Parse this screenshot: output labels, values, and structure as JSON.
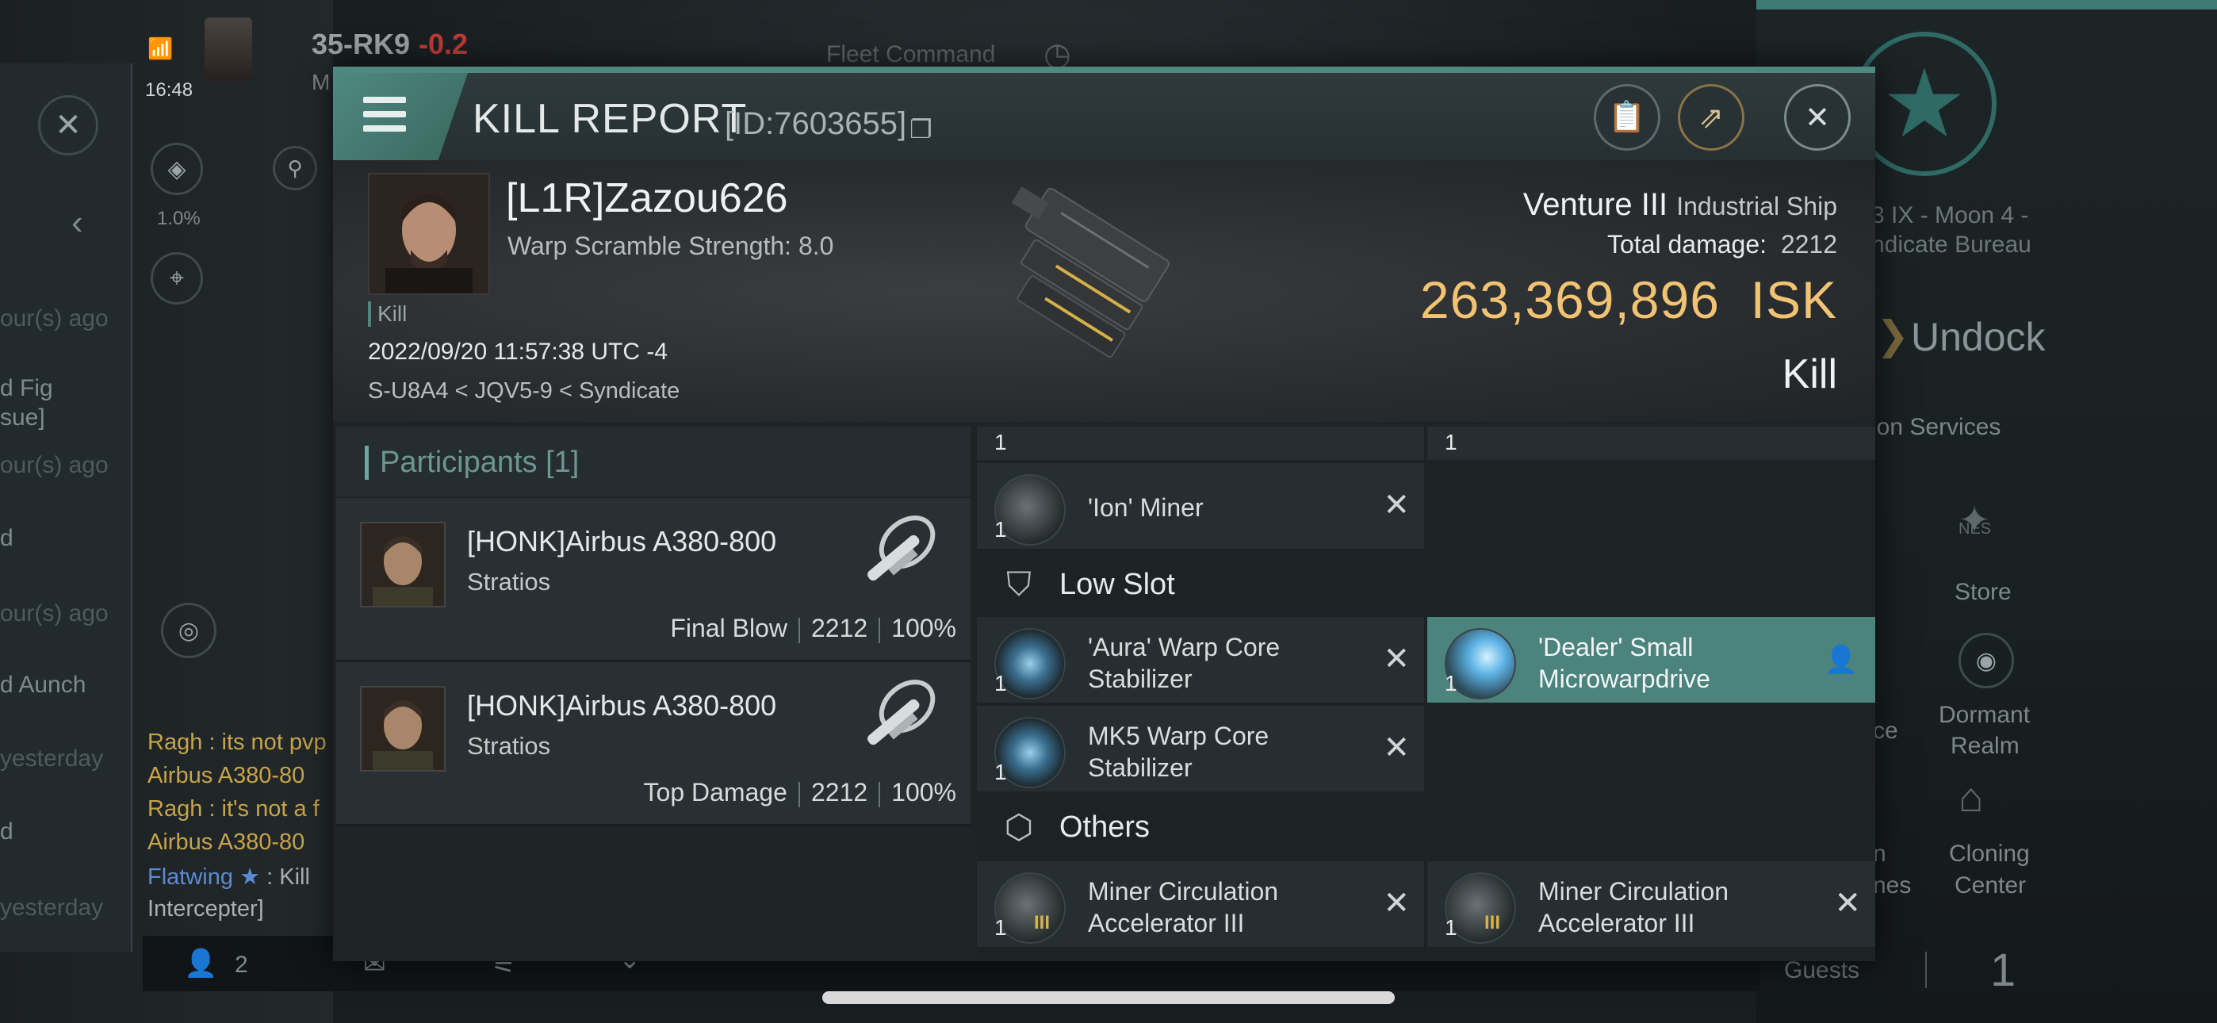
{
  "background": {
    "time": "16:48",
    "system_name": "35-RK9",
    "security": "-0.2",
    "letter_m": "M",
    "percent": "1.0%",
    "fleet_command": "Fleet Command",
    "left_list": [
      "our(s) ago",
      "d Fig",
      "sue]",
      "our(s) ago",
      "d",
      "our(s) ago",
      "d Aunch",
      "yesterday",
      "d",
      "yesterday"
    ],
    "chat": [
      {
        "name": "Ragh",
        "text": " : its not pvp"
      },
      {
        "name": "Airbus A380-80",
        "text": ""
      },
      {
        "name": "Ragh",
        "text": " : it's not a f"
      },
      {
        "name": "Airbus A380-80",
        "text": ""
      },
      {
        "name": "Flatwing",
        "text": " : Kill"
      },
      {
        "name": "",
        "text": "Intercepter]"
      }
    ],
    "bottom_count": "2",
    "right_location_line1": "3 IX - Moon 4 -",
    "right_location_line2": "ndicate Bureau",
    "undock": "Undock",
    "station_services": "ion Services",
    "store": "Store",
    "ce": "ce",
    "dormant_line1": "Dormant",
    "dormant_line2": "Realm",
    "cloning_line1": "Cloning",
    "cloning_line2": "Center",
    "nes": "NES",
    "n_partial": "n",
    "nes_partial": "nes",
    "guests_label": "Guests",
    "guests_count": "1"
  },
  "modal": {
    "title": "KILL REPORT",
    "report_id": "[ID:7603655]",
    "victim": {
      "name": "[L1R]Zazou626",
      "warp_scramble": "Warp Scramble Strength: 8.0",
      "kill_tag": "Kill",
      "datetime": "2022/09/20 11:57:38 UTC -4",
      "location": "S-U8A4 < JQV5-9 < Syndicate"
    },
    "ship": {
      "name": "Venture III",
      "class": "Industrial Ship",
      "total_damage_label": "Total damage:",
      "total_damage": "2212",
      "isk_value": "263,369,896",
      "isk_unit": "ISK",
      "result": "Kill"
    },
    "participants": {
      "header": "Participants",
      "count": "[1]",
      "rows": [
        {
          "name": "[HONK]Airbus A380-800",
          "ship": "Stratios",
          "role": "Final Blow",
          "damage": "2212",
          "percent": "100%"
        },
        {
          "name": "[HONK]Airbus A380-800",
          "ship": "Stratios",
          "role": "Top Damage",
          "damage": "2212",
          "percent": "100%"
        }
      ]
    },
    "fitting": {
      "top_qty_left": "1",
      "top_qty_right": "1",
      "ion_miner": {
        "qty": "1",
        "name": "'Ion' Miner"
      },
      "low_slot_label": "Low Slot",
      "low_slot": [
        {
          "qty": "1",
          "name": "'Aura' Warp Core Stabilizer"
        },
        {
          "qty": "1",
          "name": "'Dealer' Small Microwarpdrive"
        },
        {
          "qty": "1",
          "name": "MK5 Warp Core Stabilizer"
        }
      ],
      "others_label": "Others",
      "others": [
        {
          "qty": "1",
          "name": "Miner Circulation Accelerator III"
        },
        {
          "qty": "1",
          "name": "Miner Circulation Accelerator III"
        }
      ]
    }
  }
}
